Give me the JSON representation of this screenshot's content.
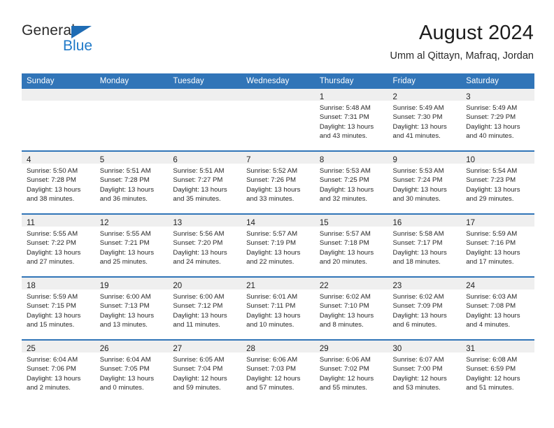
{
  "brand": {
    "name_top": "General",
    "name_bottom": "Blue",
    "accent_color": "#1f79c8",
    "triangle_color": "#1f6cb4"
  },
  "header": {
    "title": "August 2024",
    "subtitle": "Umm al Qittayn, Mafraq, Jordan",
    "header_bg": "#3175b8",
    "daynum_bg": "#efefef"
  },
  "calendar": {
    "weekday_headers": [
      "Sunday",
      "Monday",
      "Tuesday",
      "Wednesday",
      "Thursday",
      "Friday",
      "Saturday"
    ],
    "weeks": [
      [
        {
          "day": "",
          "lines": []
        },
        {
          "day": "",
          "lines": []
        },
        {
          "day": "",
          "lines": []
        },
        {
          "day": "",
          "lines": []
        },
        {
          "day": "1",
          "lines": [
            "Sunrise: 5:48 AM",
            "Sunset: 7:31 PM",
            "Daylight: 13 hours",
            "and 43 minutes."
          ]
        },
        {
          "day": "2",
          "lines": [
            "Sunrise: 5:49 AM",
            "Sunset: 7:30 PM",
            "Daylight: 13 hours",
            "and 41 minutes."
          ]
        },
        {
          "day": "3",
          "lines": [
            "Sunrise: 5:49 AM",
            "Sunset: 7:29 PM",
            "Daylight: 13 hours",
            "and 40 minutes."
          ]
        }
      ],
      [
        {
          "day": "4",
          "lines": [
            "Sunrise: 5:50 AM",
            "Sunset: 7:28 PM",
            "Daylight: 13 hours",
            "and 38 minutes."
          ]
        },
        {
          "day": "5",
          "lines": [
            "Sunrise: 5:51 AM",
            "Sunset: 7:28 PM",
            "Daylight: 13 hours",
            "and 36 minutes."
          ]
        },
        {
          "day": "6",
          "lines": [
            "Sunrise: 5:51 AM",
            "Sunset: 7:27 PM",
            "Daylight: 13 hours",
            "and 35 minutes."
          ]
        },
        {
          "day": "7",
          "lines": [
            "Sunrise: 5:52 AM",
            "Sunset: 7:26 PM",
            "Daylight: 13 hours",
            "and 33 minutes."
          ]
        },
        {
          "day": "8",
          "lines": [
            "Sunrise: 5:53 AM",
            "Sunset: 7:25 PM",
            "Daylight: 13 hours",
            "and 32 minutes."
          ]
        },
        {
          "day": "9",
          "lines": [
            "Sunrise: 5:53 AM",
            "Sunset: 7:24 PM",
            "Daylight: 13 hours",
            "and 30 minutes."
          ]
        },
        {
          "day": "10",
          "lines": [
            "Sunrise: 5:54 AM",
            "Sunset: 7:23 PM",
            "Daylight: 13 hours",
            "and 29 minutes."
          ]
        }
      ],
      [
        {
          "day": "11",
          "lines": [
            "Sunrise: 5:55 AM",
            "Sunset: 7:22 PM",
            "Daylight: 13 hours",
            "and 27 minutes."
          ]
        },
        {
          "day": "12",
          "lines": [
            "Sunrise: 5:55 AM",
            "Sunset: 7:21 PM",
            "Daylight: 13 hours",
            "and 25 minutes."
          ]
        },
        {
          "day": "13",
          "lines": [
            "Sunrise: 5:56 AM",
            "Sunset: 7:20 PM",
            "Daylight: 13 hours",
            "and 24 minutes."
          ]
        },
        {
          "day": "14",
          "lines": [
            "Sunrise: 5:57 AM",
            "Sunset: 7:19 PM",
            "Daylight: 13 hours",
            "and 22 minutes."
          ]
        },
        {
          "day": "15",
          "lines": [
            "Sunrise: 5:57 AM",
            "Sunset: 7:18 PM",
            "Daylight: 13 hours",
            "and 20 minutes."
          ]
        },
        {
          "day": "16",
          "lines": [
            "Sunrise: 5:58 AM",
            "Sunset: 7:17 PM",
            "Daylight: 13 hours",
            "and 18 minutes."
          ]
        },
        {
          "day": "17",
          "lines": [
            "Sunrise: 5:59 AM",
            "Sunset: 7:16 PM",
            "Daylight: 13 hours",
            "and 17 minutes."
          ]
        }
      ],
      [
        {
          "day": "18",
          "lines": [
            "Sunrise: 5:59 AM",
            "Sunset: 7:15 PM",
            "Daylight: 13 hours",
            "and 15 minutes."
          ]
        },
        {
          "day": "19",
          "lines": [
            "Sunrise: 6:00 AM",
            "Sunset: 7:13 PM",
            "Daylight: 13 hours",
            "and 13 minutes."
          ]
        },
        {
          "day": "20",
          "lines": [
            "Sunrise: 6:00 AM",
            "Sunset: 7:12 PM",
            "Daylight: 13 hours",
            "and 11 minutes."
          ]
        },
        {
          "day": "21",
          "lines": [
            "Sunrise: 6:01 AM",
            "Sunset: 7:11 PM",
            "Daylight: 13 hours",
            "and 10 minutes."
          ]
        },
        {
          "day": "22",
          "lines": [
            "Sunrise: 6:02 AM",
            "Sunset: 7:10 PM",
            "Daylight: 13 hours",
            "and 8 minutes."
          ]
        },
        {
          "day": "23",
          "lines": [
            "Sunrise: 6:02 AM",
            "Sunset: 7:09 PM",
            "Daylight: 13 hours",
            "and 6 minutes."
          ]
        },
        {
          "day": "24",
          "lines": [
            "Sunrise: 6:03 AM",
            "Sunset: 7:08 PM",
            "Daylight: 13 hours",
            "and 4 minutes."
          ]
        }
      ],
      [
        {
          "day": "25",
          "lines": [
            "Sunrise: 6:04 AM",
            "Sunset: 7:06 PM",
            "Daylight: 13 hours",
            "and 2 minutes."
          ]
        },
        {
          "day": "26",
          "lines": [
            "Sunrise: 6:04 AM",
            "Sunset: 7:05 PM",
            "Daylight: 13 hours",
            "and 0 minutes."
          ]
        },
        {
          "day": "27",
          "lines": [
            "Sunrise: 6:05 AM",
            "Sunset: 7:04 PM",
            "Daylight: 12 hours",
            "and 59 minutes."
          ]
        },
        {
          "day": "28",
          "lines": [
            "Sunrise: 6:06 AM",
            "Sunset: 7:03 PM",
            "Daylight: 12 hours",
            "and 57 minutes."
          ]
        },
        {
          "day": "29",
          "lines": [
            "Sunrise: 6:06 AM",
            "Sunset: 7:02 PM",
            "Daylight: 12 hours",
            "and 55 minutes."
          ]
        },
        {
          "day": "30",
          "lines": [
            "Sunrise: 6:07 AM",
            "Sunset: 7:00 PM",
            "Daylight: 12 hours",
            "and 53 minutes."
          ]
        },
        {
          "day": "31",
          "lines": [
            "Sunrise: 6:08 AM",
            "Sunset: 6:59 PM",
            "Daylight: 12 hours",
            "and 51 minutes."
          ]
        }
      ]
    ]
  }
}
